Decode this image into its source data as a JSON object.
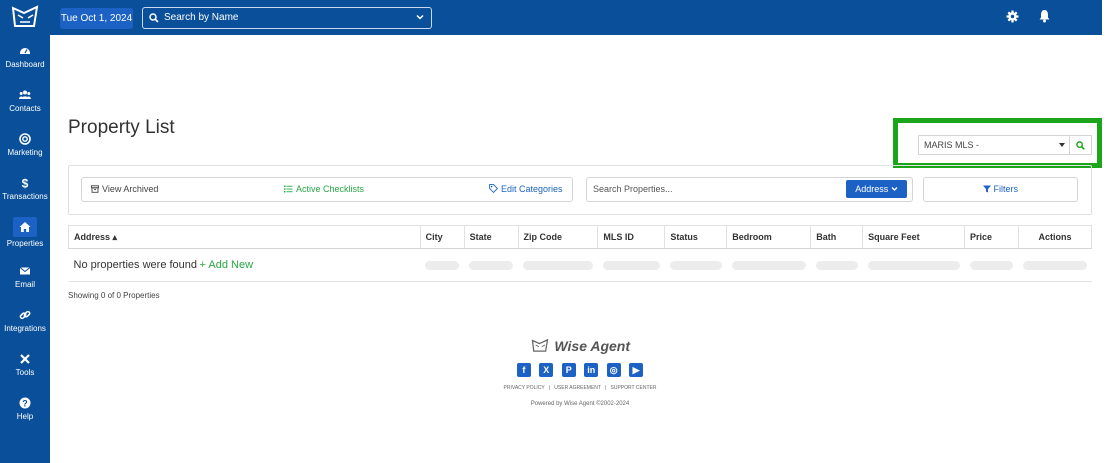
{
  "topbar": {
    "date": "Tue Oct 1, 2024",
    "search_placeholder": "Search by Name"
  },
  "sidebar": {
    "items": [
      {
        "label": "Dashboard",
        "icon": "dashboard-icon"
      },
      {
        "label": "Contacts",
        "icon": "contacts-icon"
      },
      {
        "label": "Marketing",
        "icon": "marketing-icon"
      },
      {
        "label": "Transactions",
        "icon": "dollar-icon"
      },
      {
        "label": "Properties",
        "icon": "home-icon",
        "active": true
      },
      {
        "label": "Email",
        "icon": "envelope-icon"
      },
      {
        "label": "Integrations",
        "icon": "link-icon"
      },
      {
        "label": "Tools",
        "icon": "tools-icon"
      },
      {
        "label": "Help",
        "icon": "help-icon"
      }
    ]
  },
  "page": {
    "title": "Property List"
  },
  "mls": {
    "selected": "MARIS MLS -"
  },
  "toolbar": {
    "view_archived": "View Archived",
    "active_checklists": "Active Checklists",
    "edit_categories": "Edit Categories",
    "search_placeholder": "Search Properties...",
    "address_button": "Address",
    "filters_button": "Filters"
  },
  "table": {
    "columns": [
      "Address ▴",
      "City",
      "State",
      "Zip Code",
      "MLS ID",
      "Status",
      "Bedroom",
      "Bath",
      "Square Feet",
      "Price",
      "Actions"
    ],
    "empty_message": "No properties were found",
    "add_new": "+ Add New"
  },
  "status": {
    "showing": "Showing 0 of 0 Properties"
  },
  "footer": {
    "brand": "Wise Agent",
    "social_icons": [
      "facebook-icon",
      "x-icon",
      "pinterest-icon",
      "linkedin-icon",
      "instagram-icon",
      "youtube-icon"
    ],
    "privacy": "PRIVACY POLICY",
    "user_agreement": "USER AGREEMENT",
    "support": "SUPPORT CENTER",
    "powered": "Powered by Wise Agent ©2002-2024"
  },
  "colors": {
    "nav_blue": "#0a4f99",
    "accent_blue": "#1c62c4",
    "highlight_green": "#1aa51b",
    "add_green": "#28a745"
  }
}
